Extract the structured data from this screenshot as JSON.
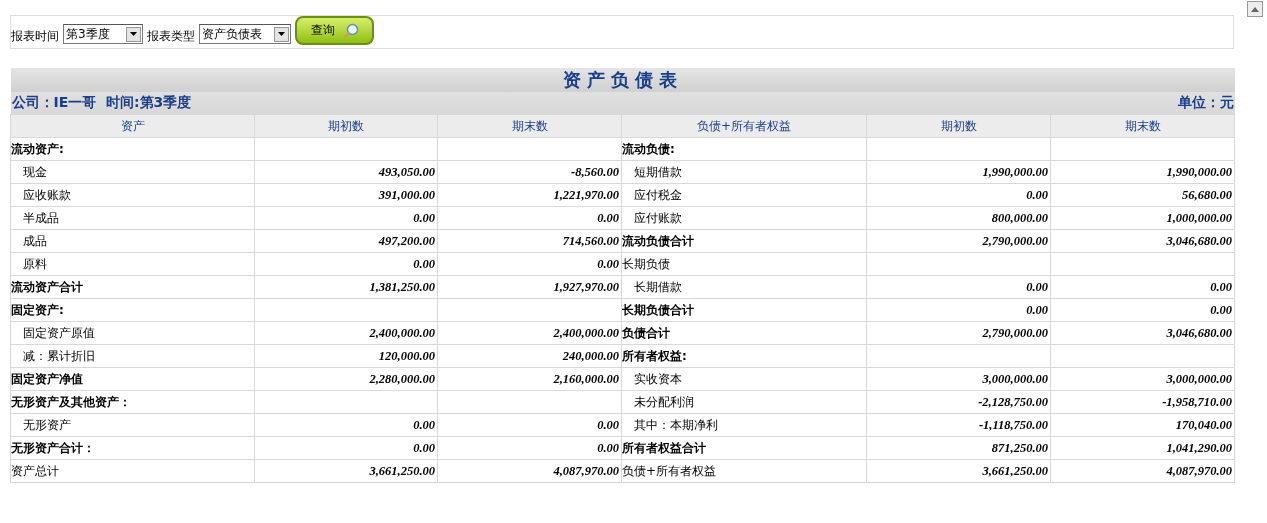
{
  "filters": {
    "period_label": "报表时间",
    "period_value": "第3季度",
    "type_label": "报表类型",
    "type_value": "资产负债表",
    "query_button": "查询"
  },
  "report": {
    "title": "资产负债表",
    "company": "公司：IE一哥  时间:第3季度",
    "unit": "单位：元",
    "columns": [
      "资产",
      "期初数",
      "期末数",
      "负债+所有者权益",
      "期初数",
      "期末数"
    ],
    "rows": [
      {
        "left": {
          "label": "流动资产:",
          "kind": "heading"
        },
        "right": {
          "label": "流动负债:",
          "kind": "heading"
        }
      },
      {
        "left": {
          "label": "现金",
          "kind": "item",
          "begin": "493,050.00",
          "end": "-8,560.00"
        },
        "right": {
          "label": "短期借款",
          "kind": "item",
          "begin": "1,990,000.00",
          "end": "1,990,000.00"
        }
      },
      {
        "left": {
          "label": "应收账款",
          "kind": "item",
          "begin": "391,000.00",
          "end": "1,221,970.00"
        },
        "right": {
          "label": "应付税金",
          "kind": "item",
          "begin": "0.00",
          "end": "56,680.00"
        }
      },
      {
        "left": {
          "label": "半成品",
          "kind": "item",
          "begin": "0.00",
          "end": "0.00"
        },
        "right": {
          "label": "应付账款",
          "kind": "item",
          "begin": "800,000.00",
          "end": "1,000,000.00"
        }
      },
      {
        "left": {
          "label": "成品",
          "kind": "item",
          "begin": "497,200.00",
          "end": "714,560.00"
        },
        "right": {
          "label": "流动负债合计",
          "kind": "total",
          "begin": "2,790,000.00",
          "end": "3,046,680.00"
        }
      },
      {
        "left": {
          "label": "原料",
          "kind": "item",
          "begin": "0.00",
          "end": "0.00"
        },
        "right": {
          "label": "长期负债",
          "kind": "plain"
        }
      },
      {
        "left": {
          "label": "流动资产合计",
          "kind": "total",
          "begin": "1,381,250.00",
          "end": "1,927,970.00"
        },
        "right": {
          "label": "长期借款",
          "kind": "item",
          "begin": "0.00",
          "end": "0.00"
        }
      },
      {
        "left": {
          "label": "固定资产:",
          "kind": "heading"
        },
        "right": {
          "label": "长期负债合计",
          "kind": "total",
          "begin": "0.00",
          "end": "0.00"
        }
      },
      {
        "left": {
          "label": "固定资产原值",
          "kind": "item",
          "begin": "2,400,000.00",
          "end": "2,400,000.00"
        },
        "right": {
          "label": "负债合计",
          "kind": "total",
          "begin": "2,790,000.00",
          "end": "3,046,680.00"
        }
      },
      {
        "left": {
          "label": "减：累计折旧",
          "kind": "item",
          "begin": "120,000.00",
          "end": "240,000.00"
        },
        "right": {
          "label": "所有者权益:",
          "kind": "heading"
        }
      },
      {
        "left": {
          "label": "固定资产净值",
          "kind": "total",
          "begin": "2,280,000.00",
          "end": "2,160,000.00"
        },
        "right": {
          "label": "实收资本",
          "kind": "item",
          "begin": "3,000,000.00",
          "end": "3,000,000.00"
        }
      },
      {
        "left": {
          "label": "无形资产及其他资产：",
          "kind": "heading"
        },
        "right": {
          "label": "未分配利润",
          "kind": "item",
          "begin": "-2,128,750.00",
          "end": "-1,958,710.00"
        }
      },
      {
        "left": {
          "label": "无形资产",
          "kind": "item",
          "begin": "0.00",
          "end": "0.00"
        },
        "right": {
          "label": "其中：本期净利",
          "kind": "item",
          "begin": "-1,118,750.00",
          "end": "170,040.00"
        }
      },
      {
        "left": {
          "label": "无形资产合计：",
          "kind": "total",
          "begin": "0.00",
          "end": "0.00"
        },
        "right": {
          "label": "所有者权益合计",
          "kind": "total",
          "begin": "871,250.00",
          "end": "1,041,290.00"
        }
      },
      {
        "left": {
          "label": "资产总计",
          "kind": "plain",
          "begin": "3,661,250.00",
          "end": "4,087,970.00"
        },
        "right": {
          "label": "负债+所有者权益",
          "kind": "plain",
          "begin": "3,661,250.00",
          "end": "4,087,970.00"
        }
      }
    ]
  }
}
